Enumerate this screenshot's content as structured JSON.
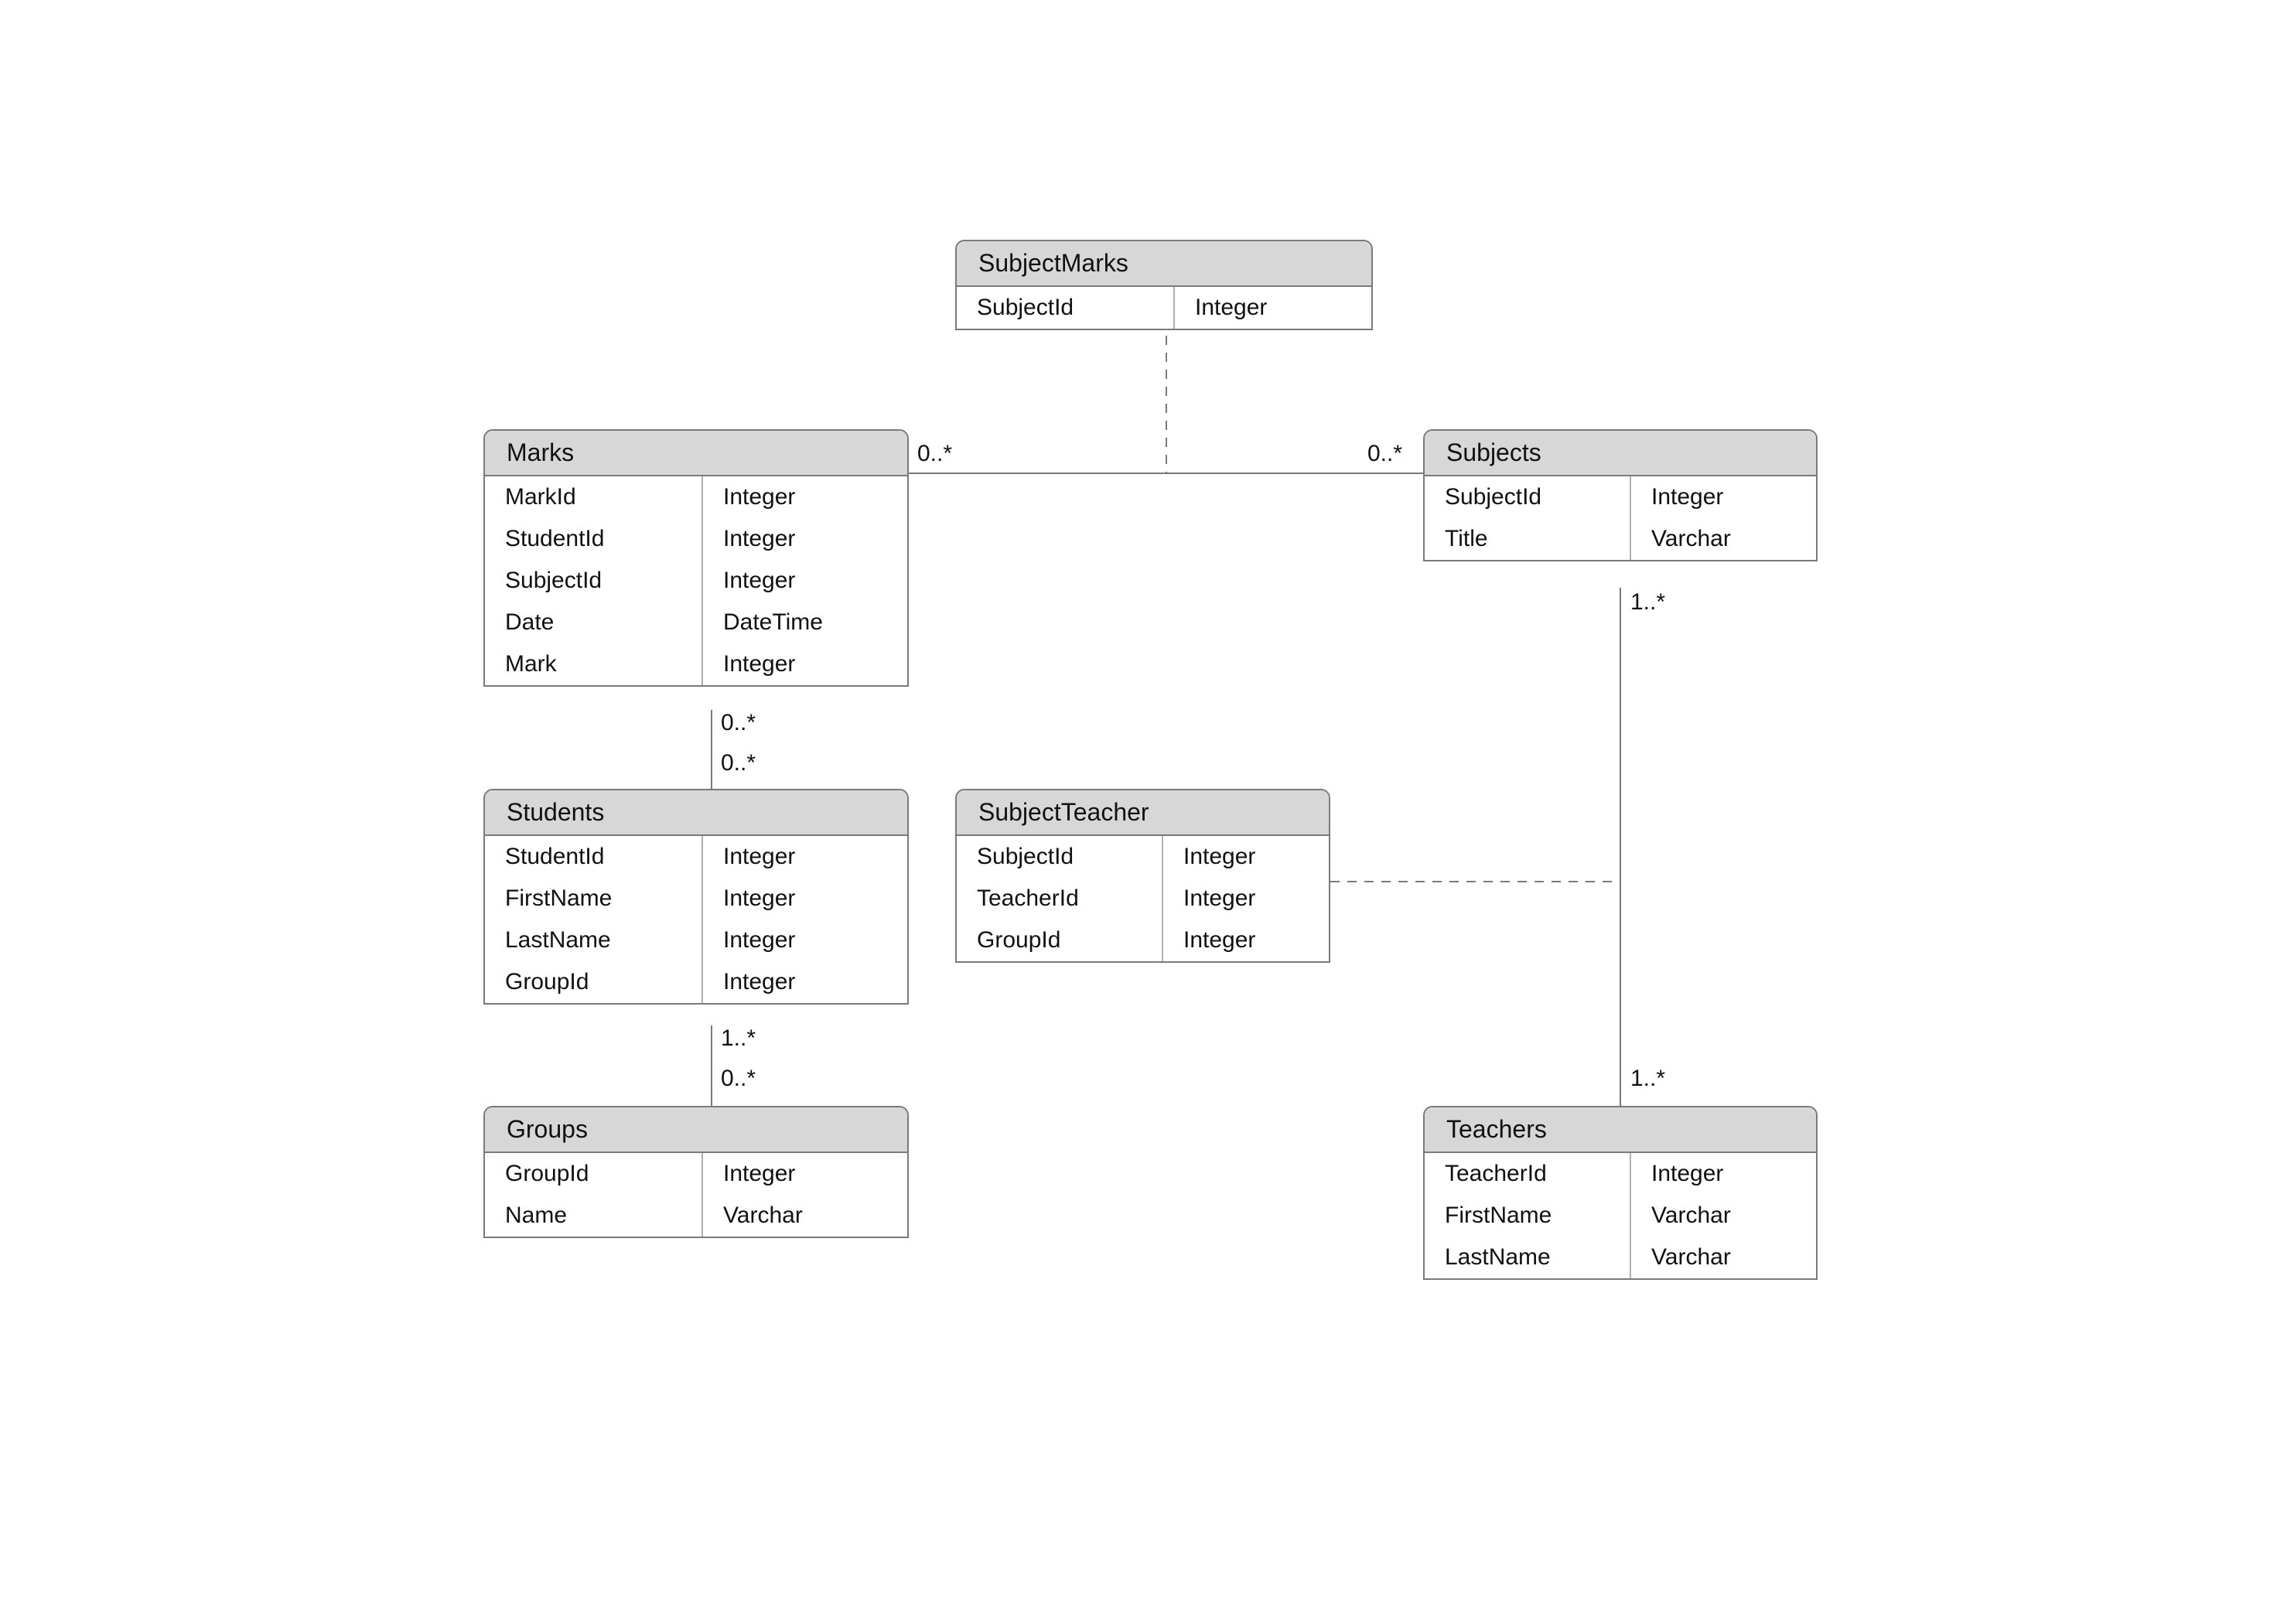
{
  "entities": {
    "subjectMarks": {
      "title": "SubjectMarks",
      "fields": [
        {
          "name": "SubjectId",
          "type": "Integer"
        }
      ]
    },
    "marks": {
      "title": "Marks",
      "fields": [
        {
          "name": "MarkId",
          "type": "Integer"
        },
        {
          "name": "StudentId",
          "type": "Integer"
        },
        {
          "name": "SubjectId",
          "type": "Integer"
        },
        {
          "name": "Date",
          "type": "DateTime"
        },
        {
          "name": "Mark",
          "type": "Integer"
        }
      ]
    },
    "subjects": {
      "title": "Subjects",
      "fields": [
        {
          "name": "SubjectId",
          "type": "Integer"
        },
        {
          "name": "Title",
          "type": "Varchar"
        }
      ]
    },
    "students": {
      "title": "Students",
      "fields": [
        {
          "name": "StudentId",
          "type": "Integer"
        },
        {
          "name": "FirstName",
          "type": "Integer"
        },
        {
          "name": "LastName",
          "type": "Integer"
        },
        {
          "name": "GroupId",
          "type": "Integer"
        }
      ]
    },
    "subjectTeacher": {
      "title": "SubjectTeacher",
      "fields": [
        {
          "name": "SubjectId",
          "type": "Integer"
        },
        {
          "name": "TeacherId",
          "type": "Integer"
        },
        {
          "name": "GroupId",
          "type": "Integer"
        }
      ]
    },
    "groups": {
      "title": "Groups",
      "fields": [
        {
          "name": "GroupId",
          "type": "Integer"
        },
        {
          "name": "Name",
          "type": "Varchar"
        }
      ]
    },
    "teachers": {
      "title": "Teachers",
      "fields": [
        {
          "name": "TeacherId",
          "type": "Integer"
        },
        {
          "name": "FirstName",
          "type": "Varchar"
        },
        {
          "name": "LastName",
          "type": "Varchar"
        }
      ]
    }
  },
  "multiplicities": {
    "marks_to_subjects_left": "0..*",
    "marks_to_subjects_right": "0..*",
    "marks_bottom": "0..*",
    "students_top": "0..*",
    "students_bottom": "1..*",
    "groups_top": "0..*",
    "subjects_bottom": "1..*",
    "teachers_top": "1..*"
  }
}
